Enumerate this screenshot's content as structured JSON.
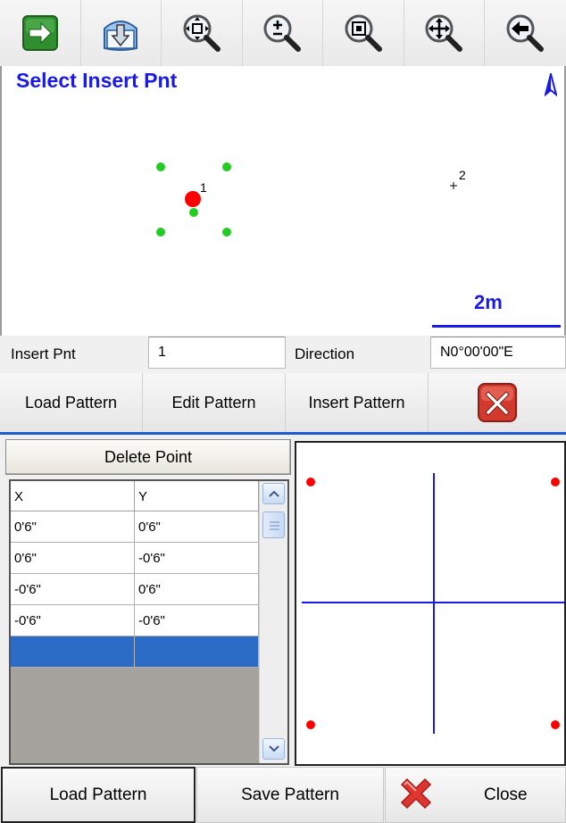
{
  "toolbar": {
    "buttons": [
      {
        "icon": "green-arrow-right-icon"
      },
      {
        "icon": "download-arrow-icon"
      },
      {
        "icon": "zoom-extents-icon"
      },
      {
        "icon": "zoom-plus-minus-icon"
      },
      {
        "icon": "zoom-window-icon"
      },
      {
        "icon": "zoom-pan-icon"
      },
      {
        "icon": "zoom-previous-icon"
      }
    ]
  },
  "map": {
    "title": "Select Insert Pnt",
    "points": [
      {
        "label": "1"
      },
      {
        "label": "2"
      }
    ],
    "scale_label": "2m",
    "colors": {
      "title": "#1a1ae6",
      "insert_point": "#ff0000",
      "pattern_point": "#22cc22"
    }
  },
  "fields": {
    "insert_pnt_label": "Insert Pnt",
    "insert_pnt_value": "1",
    "direction_label": "Direction",
    "direction_value": "N0°00'00\"E"
  },
  "actions": {
    "load_pattern": "Load Pattern",
    "edit_pattern": "Edit Pattern",
    "insert_pattern": "Insert Pattern",
    "cancel_icon": "red-x-icon"
  },
  "pattern_editor": {
    "delete_point": "Delete Point",
    "columns": [
      "X",
      "Y"
    ],
    "rows": [
      [
        "0'6\"",
        "0'6\""
      ],
      [
        "0'6\"",
        "-0'6\""
      ],
      [
        "-0'6\"",
        "0'6\""
      ],
      [
        "-0'6\"",
        "-0'6\""
      ],
      [
        "",
        ""
      ]
    ],
    "selected_row": 4
  },
  "bottom": {
    "load_pattern": "Load Pattern",
    "save_pattern": "Save Pattern",
    "close": "Close",
    "close_icon": "red-x-icon"
  }
}
